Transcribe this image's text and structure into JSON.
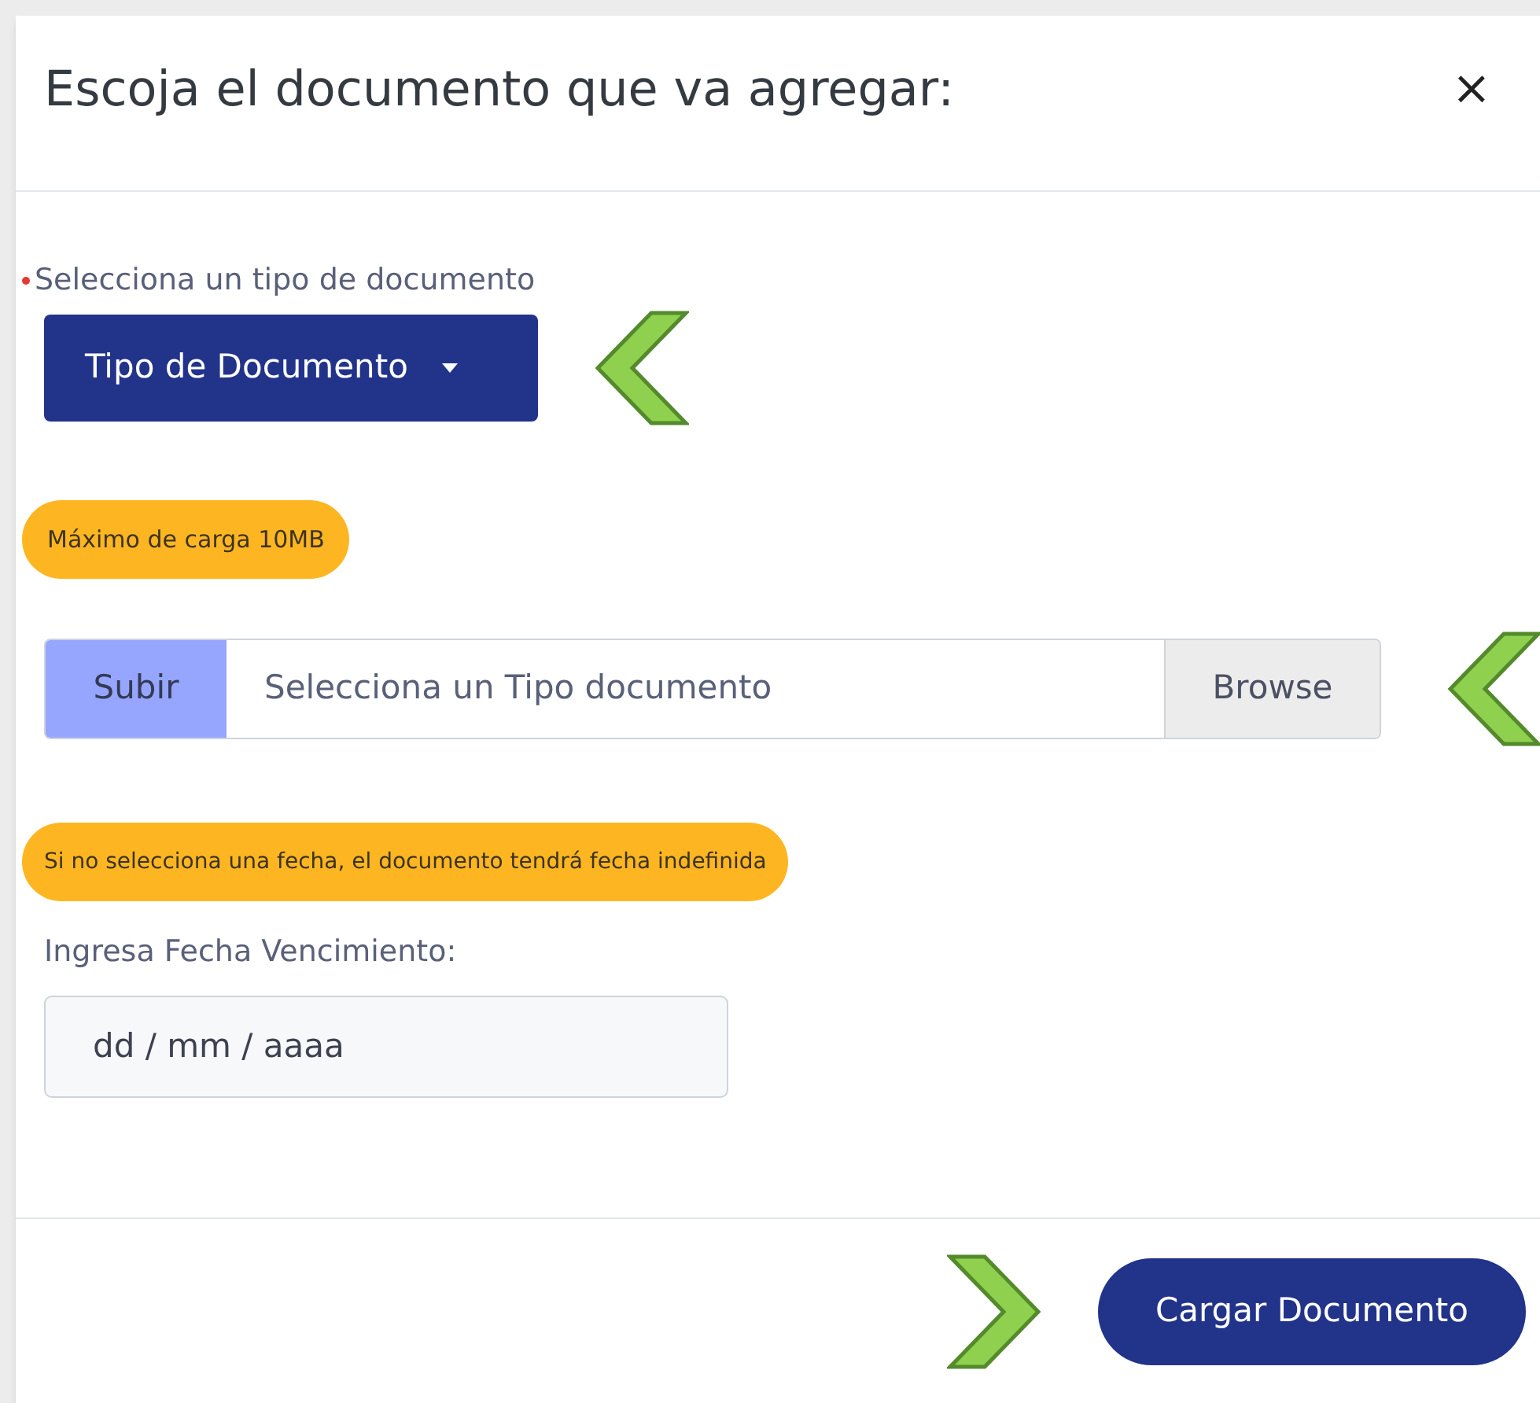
{
  "modal": {
    "title": "Escoja el documento que va agregar:",
    "close": "×"
  },
  "document_type": {
    "required": true,
    "label": "Selecciona un tipo de documento",
    "button": "Tipo de Documento"
  },
  "size_notice": "Máximo de carga 10MB",
  "file_upload": {
    "prefix": "Subir",
    "placeholder": "Selecciona un Tipo documento",
    "browse": "Browse"
  },
  "date_notice": "Si no selecciona una fecha, el documento tendrá fecha indefinida",
  "expiry_date": {
    "label": "Ingresa Fecha Vencimiento:",
    "placeholder": "dd / mm / aaaa"
  },
  "submit": "Cargar Documento"
}
